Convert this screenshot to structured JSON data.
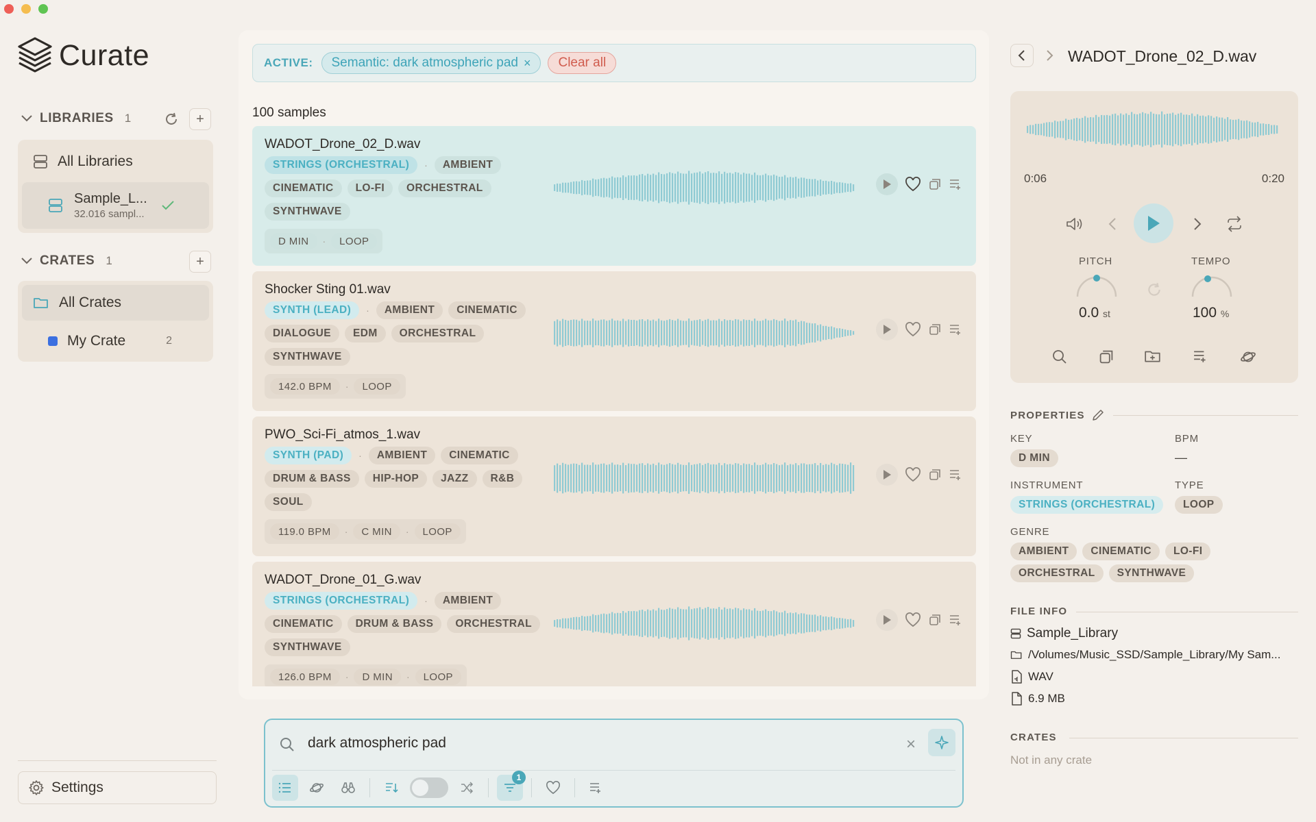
{
  "window": {
    "controls": [
      "close",
      "minimize",
      "maximize"
    ],
    "colors": {
      "close": "#ee5f57",
      "minimize": "#f5bd4f",
      "maximize": "#5fc452"
    }
  },
  "app": {
    "name": "Curate"
  },
  "sidebar": {
    "libraries": {
      "title": "LIBRARIES",
      "count": "1",
      "all_label": "All Libraries",
      "items": [
        {
          "name": "Sample_L...",
          "sub": "32.016 sampl..."
        }
      ]
    },
    "crates": {
      "title": "CRATES",
      "count": "1",
      "all_label": "All Crates",
      "items": [
        {
          "name": "My Crate",
          "count": "2",
          "color": "#3b6fe0"
        }
      ]
    },
    "settings_label": "Settings"
  },
  "filters": {
    "label": "ACTIVE:",
    "chips": [
      "Semantic: dark atmospheric pad"
    ],
    "clear_label": "Clear all"
  },
  "results": {
    "count_label": "100 samples",
    "items": [
      {
        "name": "WADOT_Drone_02_D.wav",
        "instrument": "STRINGS (ORCHESTRAL)",
        "tags": [
          "AMBIENT",
          "CINEMATIC",
          "LO-FI",
          "ORCHESTRAL",
          "SYNTHWAVE"
        ],
        "meta": [
          "D MIN",
          "LOOP"
        ],
        "selected": true
      },
      {
        "name": "Shocker Sting 01.wav",
        "instrument": "SYNTH (LEAD)",
        "tags": [
          "AMBIENT",
          "CINEMATIC",
          "DIALOGUE",
          "EDM",
          "ORCHESTRAL",
          "SYNTHWAVE"
        ],
        "meta": [
          "142.0 BPM",
          "LOOP"
        ],
        "selected": false
      },
      {
        "name": "PWO_Sci-Fi_atmos_1.wav",
        "instrument": "SYNTH (PAD)",
        "tags": [
          "AMBIENT",
          "CINEMATIC",
          "DRUM & BASS",
          "HIP-HOP",
          "JAZZ",
          "R&B",
          "SOUL"
        ],
        "meta": [
          "119.0 BPM",
          "C MIN",
          "LOOP"
        ],
        "selected": false
      },
      {
        "name": "WADOT_Drone_01_G.wav",
        "instrument": "STRINGS (ORCHESTRAL)",
        "tags": [
          "AMBIENT",
          "CINEMATIC",
          "DRUM & BASS",
          "ORCHESTRAL",
          "SYNTHWAVE"
        ],
        "meta": [
          "126.0 BPM",
          "D MIN",
          "LOOP"
        ],
        "selected": false
      }
    ]
  },
  "search": {
    "value": "dark atmospheric pad",
    "filter_badge": "1"
  },
  "detail": {
    "title": "WADOT_Drone_02_D.wav",
    "player": {
      "elapsed": "0:06",
      "duration": "0:20",
      "progress": 0.3
    },
    "pitch": {
      "label": "PITCH",
      "value": "0.0",
      "unit": "st"
    },
    "tempo": {
      "label": "TEMPO",
      "value": "100",
      "unit": "%"
    },
    "properties": {
      "title": "PROPERTIES",
      "key_label": "KEY",
      "key": "D MIN",
      "bpm_label": "BPM",
      "bpm": "—",
      "instrument_label": "INSTRUMENT",
      "instrument": "STRINGS (ORCHESTRAL)",
      "type_label": "TYPE",
      "type": "LOOP",
      "genre_label": "GENRE",
      "genres": [
        "AMBIENT",
        "CINEMATIC",
        "LO-FI",
        "ORCHESTRAL",
        "SYNTHWAVE"
      ]
    },
    "file_info": {
      "title": "FILE INFO",
      "library": "Sample_Library",
      "path": "/Volumes/Music_SSD/Sample_Library/My Sam...",
      "format": "WAV",
      "size": "6.9 MB"
    },
    "crates": {
      "title": "CRATES",
      "empty": "Not in any crate"
    }
  },
  "colors": {
    "accent": "#4aa7b8",
    "danger": "#d05c4e",
    "background": "#f4f0eb"
  }
}
